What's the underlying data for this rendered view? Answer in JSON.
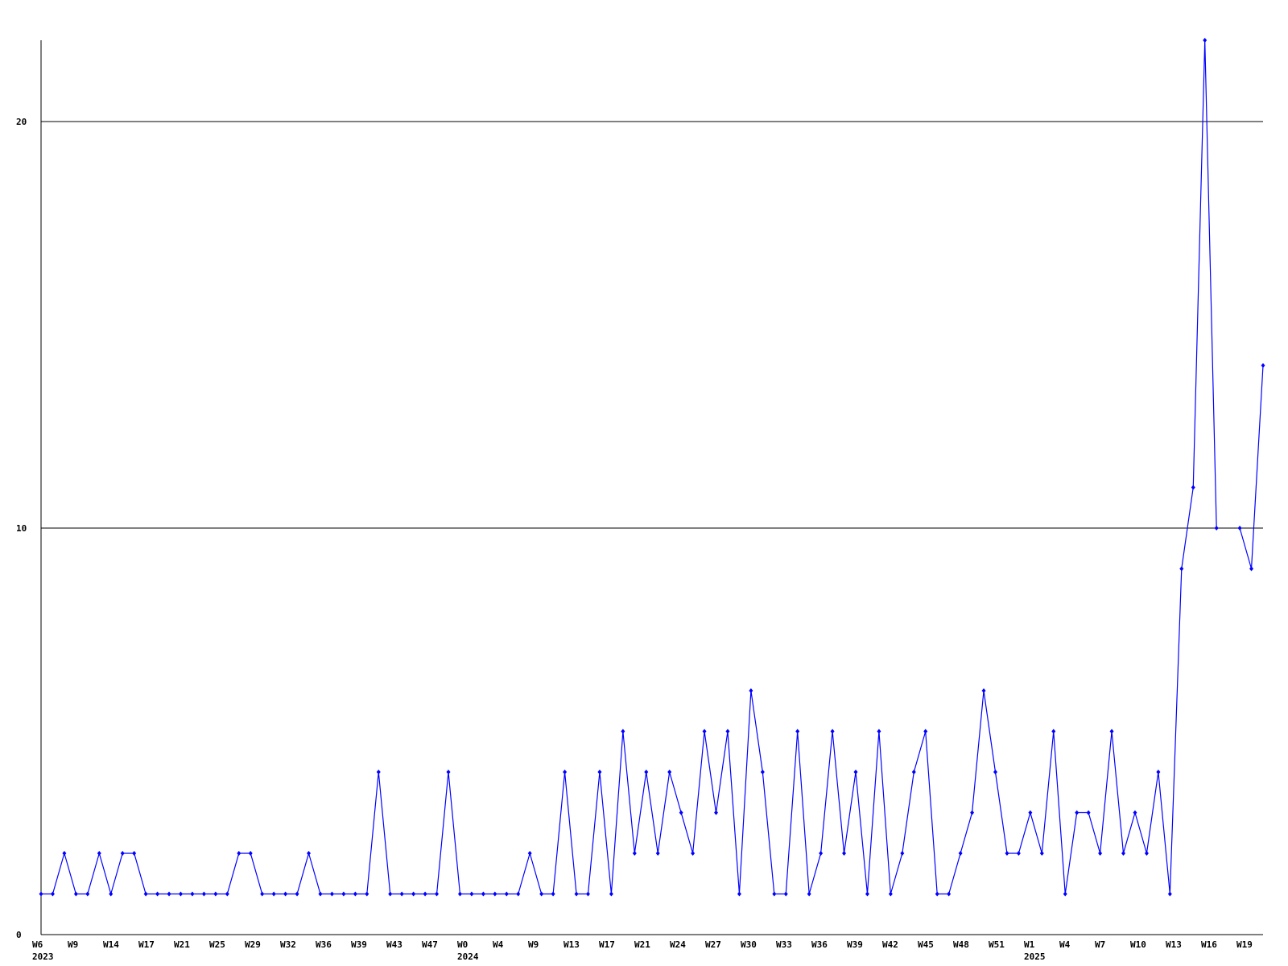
{
  "chart_data": {
    "type": "line",
    "title": "",
    "xlabel": "",
    "ylabel": "",
    "ylim": [
      0,
      22
    ],
    "y_ticks": [
      "0",
      "10",
      "20"
    ],
    "grid": "horizontal",
    "colors": {
      "line": "#0000ff",
      "marker": "#0000ff",
      "axis": "#000000",
      "grid": "#000000"
    },
    "x_ticks": [
      {
        "label": "W6",
        "year": "2023"
      },
      {
        "label": "W9"
      },
      {
        "label": "W14"
      },
      {
        "label": "W17"
      },
      {
        "label": "W21"
      },
      {
        "label": "W25"
      },
      {
        "label": "W29"
      },
      {
        "label": "W32"
      },
      {
        "label": "W36"
      },
      {
        "label": "W39"
      },
      {
        "label": "W43"
      },
      {
        "label": "W47"
      },
      {
        "label": "W0",
        "year": "2024"
      },
      {
        "label": "W4"
      },
      {
        "label": "W9"
      },
      {
        "label": "W13"
      },
      {
        "label": "W17"
      },
      {
        "label": "W21"
      },
      {
        "label": "W24"
      },
      {
        "label": "W27"
      },
      {
        "label": "W30"
      },
      {
        "label": "W33"
      },
      {
        "label": "W36"
      },
      {
        "label": "W39"
      },
      {
        "label": "W42"
      },
      {
        "label": "W45"
      },
      {
        "label": "W48"
      },
      {
        "label": "W51"
      },
      {
        "label": "W1",
        "year": "2025"
      },
      {
        "label": "W4"
      },
      {
        "label": "W7"
      },
      {
        "label": "W10"
      },
      {
        "label": "W13"
      },
      {
        "label": "W16"
      },
      {
        "label": "W19"
      }
    ],
    "values": [
      1,
      1,
      2,
      1,
      1,
      2,
      1,
      2,
      2,
      1,
      1,
      1,
      1,
      1,
      1,
      1,
      1,
      2,
      2,
      1,
      1,
      1,
      1,
      2,
      1,
      1,
      1,
      1,
      1,
      4,
      1,
      1,
      1,
      1,
      1,
      4,
      1,
      1,
      1,
      1,
      1,
      1,
      2,
      1,
      1,
      4,
      1,
      1,
      4,
      1,
      5,
      2,
      4,
      2,
      4,
      3,
      2,
      5,
      3,
      5,
      1,
      6,
      4,
      1,
      1,
      5,
      1,
      2,
      5,
      2,
      4,
      1,
      5,
      1,
      2,
      4,
      5,
      1,
      1,
      2,
      3,
      6,
      4,
      2,
      2,
      3,
      2,
      5,
      1,
      3,
      3,
      2,
      5,
      2,
      3,
      2,
      4,
      1,
      9,
      11,
      22,
      10,
      null,
      10,
      9,
      14
    ]
  }
}
